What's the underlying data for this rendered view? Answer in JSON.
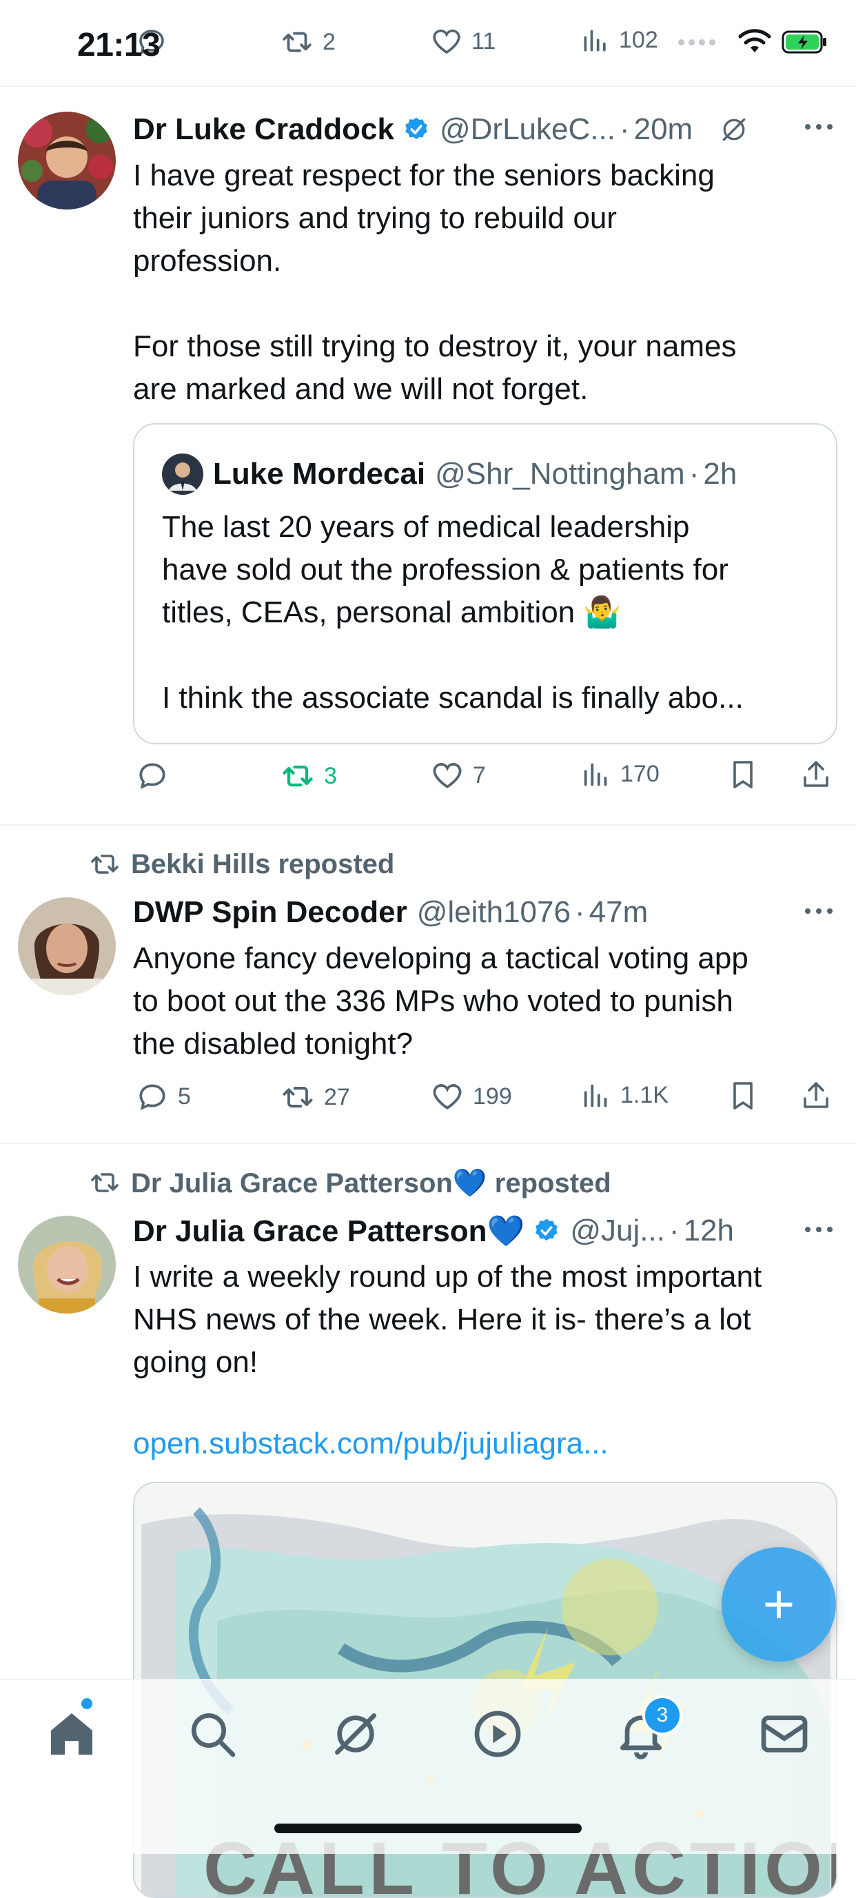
{
  "status_bar": {
    "time": "21:13",
    "battery_charging": true
  },
  "top_partial_actions": {
    "reply": "",
    "retweets": "2",
    "likes": "11",
    "views": "102"
  },
  "tweets": [
    {
      "author": "Dr Luke Craddock",
      "verified": true,
      "handle": "@DrLukeC...",
      "time": "20m",
      "text": "I have great respect for the seniors backing\ntheir juniors and trying to rebuild our\nprofession.\n\nFor those still trying to destroy it, your names\nare marked and we will not forget.",
      "quote": {
        "author": "Luke Mordecai",
        "handle": "@Shr_Nottingham",
        "time": "2h",
        "text": "The last 20 years of medical leadership\nhave sold out the profession & patients for\ntitles, CEAs, personal ambition 🤷‍♂️\n\nI think the associate scandal is finally abo..."
      },
      "stats": {
        "replies": "",
        "retweets": "3",
        "likes": "7",
        "views": "170"
      },
      "retweeted_by_me": true
    },
    {
      "reposted_by": "Bekki Hills reposted",
      "author": "DWP Spin Decoder",
      "verified": false,
      "handle": "@leith1076",
      "time": "47m",
      "text": "Anyone fancy developing a tactical voting app\nto boot out the 336 MPs who voted to punish\nthe disabled tonight?",
      "stats": {
        "replies": "5",
        "retweets": "27",
        "likes": "199",
        "views": "1.1K"
      }
    },
    {
      "reposted_by": "Dr Julia Grace Patterson💙 reposted",
      "author": "Dr Julia Grace Patterson💙",
      "verified": true,
      "handle": "@Juj...",
      "time": "12h",
      "text": "I write a weekly round up of the most important\nNHS news of the week. Here it is- there’s a lot\ngoing on!",
      "link": "open.substack.com/pub/jujuliagra...",
      "media_text": "CALL TO ACTION"
    }
  ],
  "fab": {
    "label": "+"
  },
  "tabbar": {
    "items": [
      "home-icon",
      "search-icon",
      "grok-icon",
      "play-icon",
      "notifications-icon",
      "messages-icon"
    ],
    "notifications_badge": "3"
  },
  "colors": {
    "accent": "#1d9bf0",
    "retweet_green": "#00ba7c",
    "muted": "#536471"
  }
}
